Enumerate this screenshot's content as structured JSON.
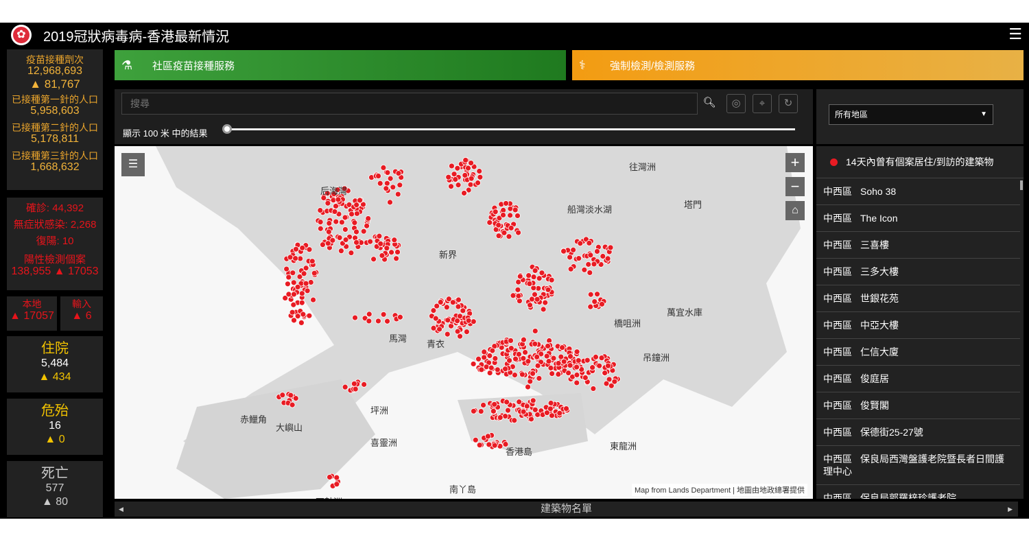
{
  "header": {
    "title": "2019冠狀病毒病-香港最新情況",
    "menu_icon": "hamburger-icon"
  },
  "vaccine": {
    "doses_label": "疫苗接種劑次",
    "doses": "12,968,693",
    "doses_change": "▲ 81,767",
    "first_label": "已接種第一針的人口",
    "first": "5,958,603",
    "second_label": "已接種第二針的人口",
    "second": "5,178,811",
    "third_label": "已接種第三針的人口",
    "third": "1,668,632"
  },
  "cases": {
    "confirmed": "確診: 44,392",
    "asymptomatic": "無症狀感染: 2,268",
    "repositive": "復陽: 10",
    "positive_label": "陽性檢測個案",
    "positive": "138,955 ▲ 17053"
  },
  "local": {
    "label": "本地",
    "value": "▲ 17057"
  },
  "imported": {
    "label": "輸入",
    "value": "▲ 6"
  },
  "hospital": {
    "label": "住院",
    "value": "5,484",
    "change": "▲ 434"
  },
  "critical": {
    "label": "危殆",
    "value": "16",
    "change": "▲ 0"
  },
  "death": {
    "label": "死亡",
    "value": "577",
    "change": "▲ 80"
  },
  "services": [
    {
      "label": "社區疫苗接種服務",
      "color": "#2e8b2e"
    },
    {
      "label": "強制檢測/檢測服務",
      "color": "#f0a530"
    }
  ],
  "search": {
    "placeholder": "搜尋",
    "radius_label": "顯示 100 米 中的結果",
    "radius_value": 100
  },
  "region_select": {
    "value": "所有地區"
  },
  "map": {
    "places": [
      "往灣洲",
      "后海灣",
      "船灣淡水湖",
      "塔門",
      "新界",
      "萬宜水庫",
      "橋咀洲",
      "馬灣",
      "青衣",
      "吊鐘洲",
      "赤鱲角",
      "大嶼山",
      "喜靈洲",
      "香港島",
      "東龍洲",
      "南丫島",
      "石鼓洲",
      "坪洲"
    ],
    "attribution": "Map from Lands Department | 地圖由地政總署提供",
    "marker_color": "#e81b23"
  },
  "list": {
    "header": "14天內曾有個案居住/到訪的建築物",
    "items": [
      {
        "district": "中西區",
        "name": "Soho 38"
      },
      {
        "district": "中西區",
        "name": "The Icon"
      },
      {
        "district": "中西區",
        "name": "三喜樓"
      },
      {
        "district": "中西區",
        "name": "三多大樓"
      },
      {
        "district": "中西區",
        "name": "世銀花苑"
      },
      {
        "district": "中西區",
        "name": "中亞大樓"
      },
      {
        "district": "中西區",
        "name": "仁信大廈"
      },
      {
        "district": "中西區",
        "name": "俊庭居"
      },
      {
        "district": "中西區",
        "name": "俊賢閣"
      },
      {
        "district": "中西區",
        "name": "保德街25-27號"
      },
      {
        "district": "中西區",
        "name": "保良局西灣盤護老院暨長者日間護理中心"
      },
      {
        "district": "中西區",
        "name": "保良局郭羅梓珍護老院"
      }
    ]
  },
  "bottom": {
    "label": "建築物名單"
  }
}
